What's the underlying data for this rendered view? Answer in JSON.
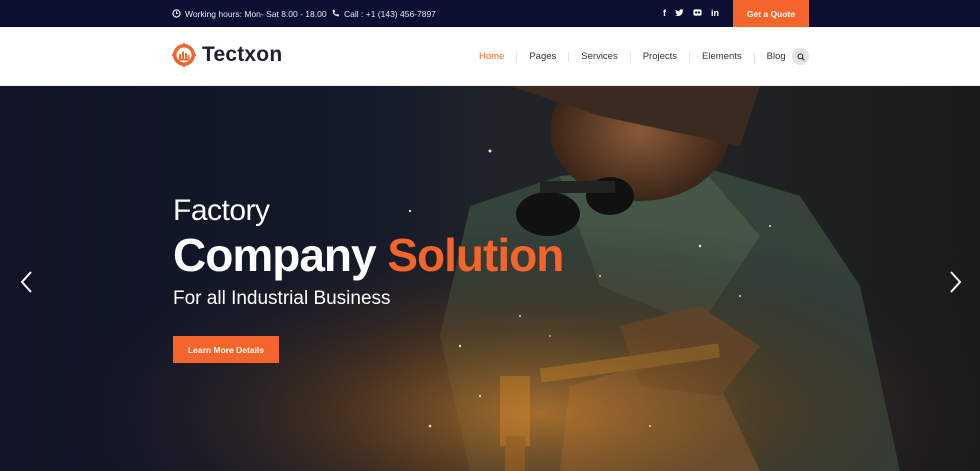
{
  "topbar": {
    "working_hours": "Working hours: Mon- Sat 8.00 - 18.00",
    "call": "Call : +1 (143) 456-7897",
    "social": [
      "f",
      "t",
      "g",
      "in"
    ],
    "quote_button": "Get a Quote"
  },
  "header": {
    "logo_text": "Tectxon",
    "nav": [
      {
        "label": "Home",
        "active": true
      },
      {
        "label": "Pages"
      },
      {
        "label": "Services"
      },
      {
        "label": "Projects"
      },
      {
        "label": "Elements"
      },
      {
        "label": "Blog"
      }
    ],
    "search_icon": "search-icon"
  },
  "hero": {
    "line1": "Factory",
    "line2_main": "Company ",
    "line2_accent": "Solution",
    "line3": "For all Industrial Business",
    "button": "Learn More Details"
  },
  "colors": {
    "accent": "#f5642a",
    "topbar_bg": "#0b1033"
  }
}
